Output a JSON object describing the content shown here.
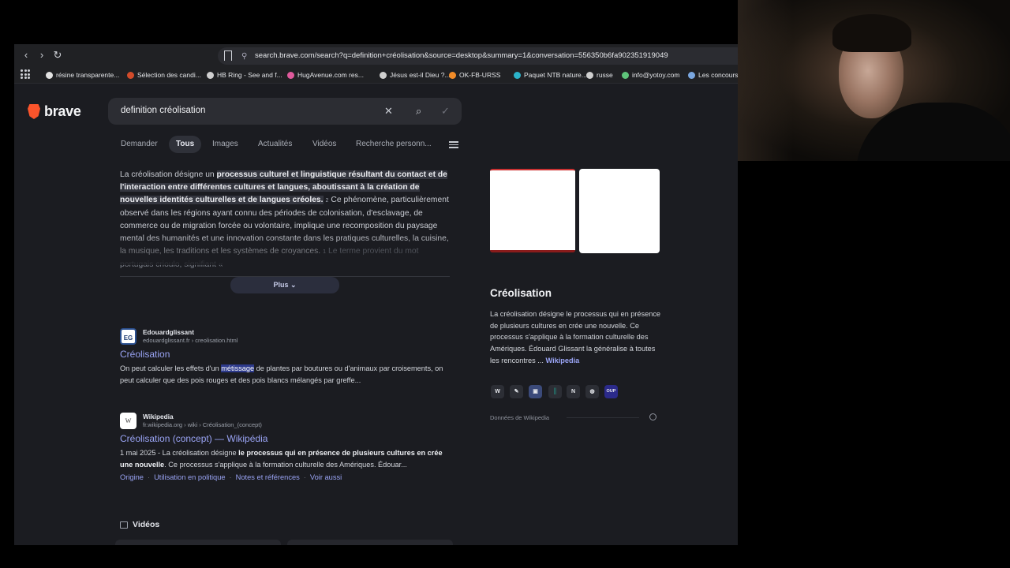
{
  "browser": {
    "url": "search.brave.com/search?q=definition+créolisation&source=desktop&summary=1&conversation=556350b6fa902351919049",
    "bookmarks": [
      {
        "label": "résine transparente...",
        "color": "#e2e2e2"
      },
      {
        "label": "Sélection des candi...",
        "color": "#d24b2a"
      },
      {
        "label": "HB Ring - See and f...",
        "color": "#cfcfcf"
      },
      {
        "label": "HugAvenue.com res...",
        "color": "#e05a9c"
      },
      {
        "label": "Jésus est-il Dieu ?...",
        "color": "#cfcfcf"
      },
      {
        "label": "OK-FB-URSS",
        "color": "#f28c28"
      },
      {
        "label": "Paquet NTB nature...",
        "color": "#2bb3c9"
      },
      {
        "label": "russe",
        "color": "#cfcfcf"
      },
      {
        "label": "info@yotoy.com",
        "color": "#5ec47a"
      },
      {
        "label": "Les concours",
        "color": "#7aa7e0"
      }
    ]
  },
  "brand": {
    "name": "brave",
    "accent": "#fb542b"
  },
  "search": {
    "query": "definition créolisation"
  },
  "tabs": [
    {
      "label": "Demander"
    },
    {
      "label": "Tous",
      "active": true
    },
    {
      "label": "Images"
    },
    {
      "label": "Actualités"
    },
    {
      "label": "Vidéos"
    },
    {
      "label": "Recherche personn..."
    }
  ],
  "summary": {
    "lead": "La créolisation désigne un ",
    "highlight": "processus culturel et linguistique résultant du contact et de l'interaction entre différentes cultures et langues, aboutissant à la création de nouvelles identités culturelles et de langues créoles.",
    "cite1": "2",
    "body": "Ce phénomène, particulièrement observé dans les régions ayant connu des périodes de colonisation, d'esclavage, de commerce ou de migration forcée ou volontaire, implique une recomposition du paysage mental des humanités et une innovation constante dans les pratiques culturelles, la cuisine, la musique, les traditions et les systèmes de croyances.",
    "cite2": "1",
    "tail": "Le terme provient du mot portugais crioulo, signifiant «",
    "more_label": "Plus"
  },
  "results": [
    {
      "site": "Edouardglissant",
      "favicon": "EG",
      "url": "edouardglissant.fr › creolisation.html",
      "title": "Créolisation",
      "snippet_pre": "On peut calculer les effets d'un ",
      "snippet_hl": "métissage",
      "snippet_post": " de plantes par boutures ou d'animaux par croisements, on peut calculer que des pois rouges et des pois blancs mélangés par greffe..."
    },
    {
      "site": "Wikipedia",
      "favicon": "W",
      "url": "fr.wikipedia.org › wiki › Créolisation_(concept)",
      "title": "Créolisation (concept) — Wikipédia",
      "snippet_date": "1 mai 2025 - ",
      "snippet_pre": "La créolisation désigne ",
      "snippet_bold1": "le processus qui en présence de plusieurs cultures en crée une nouvelle",
      "snippet_post": ". Ce processus s'applique à la formation culturelle des Amériques. Édouar...",
      "sublinks": [
        "Origine",
        "Utilisation en politique",
        "Notes et références",
        "Voir aussi"
      ]
    }
  ],
  "videos": {
    "heading": "Vidéos"
  },
  "knowledge_panel": {
    "title": "Créolisation",
    "description": "La créolisation désigne le processus qui en présence de plusieurs cultures en crée une nouvelle. Ce processus s'applique à la formation culturelle des Amériques. Édouard Glissant la généralise à toutes les rencontres ...",
    "source_link": "Wikipedia",
    "sources": [
      "W",
      "✎",
      "▣",
      "║",
      "N",
      "◍",
      "OUP"
    ],
    "footer": "Données de Wikipedia"
  }
}
